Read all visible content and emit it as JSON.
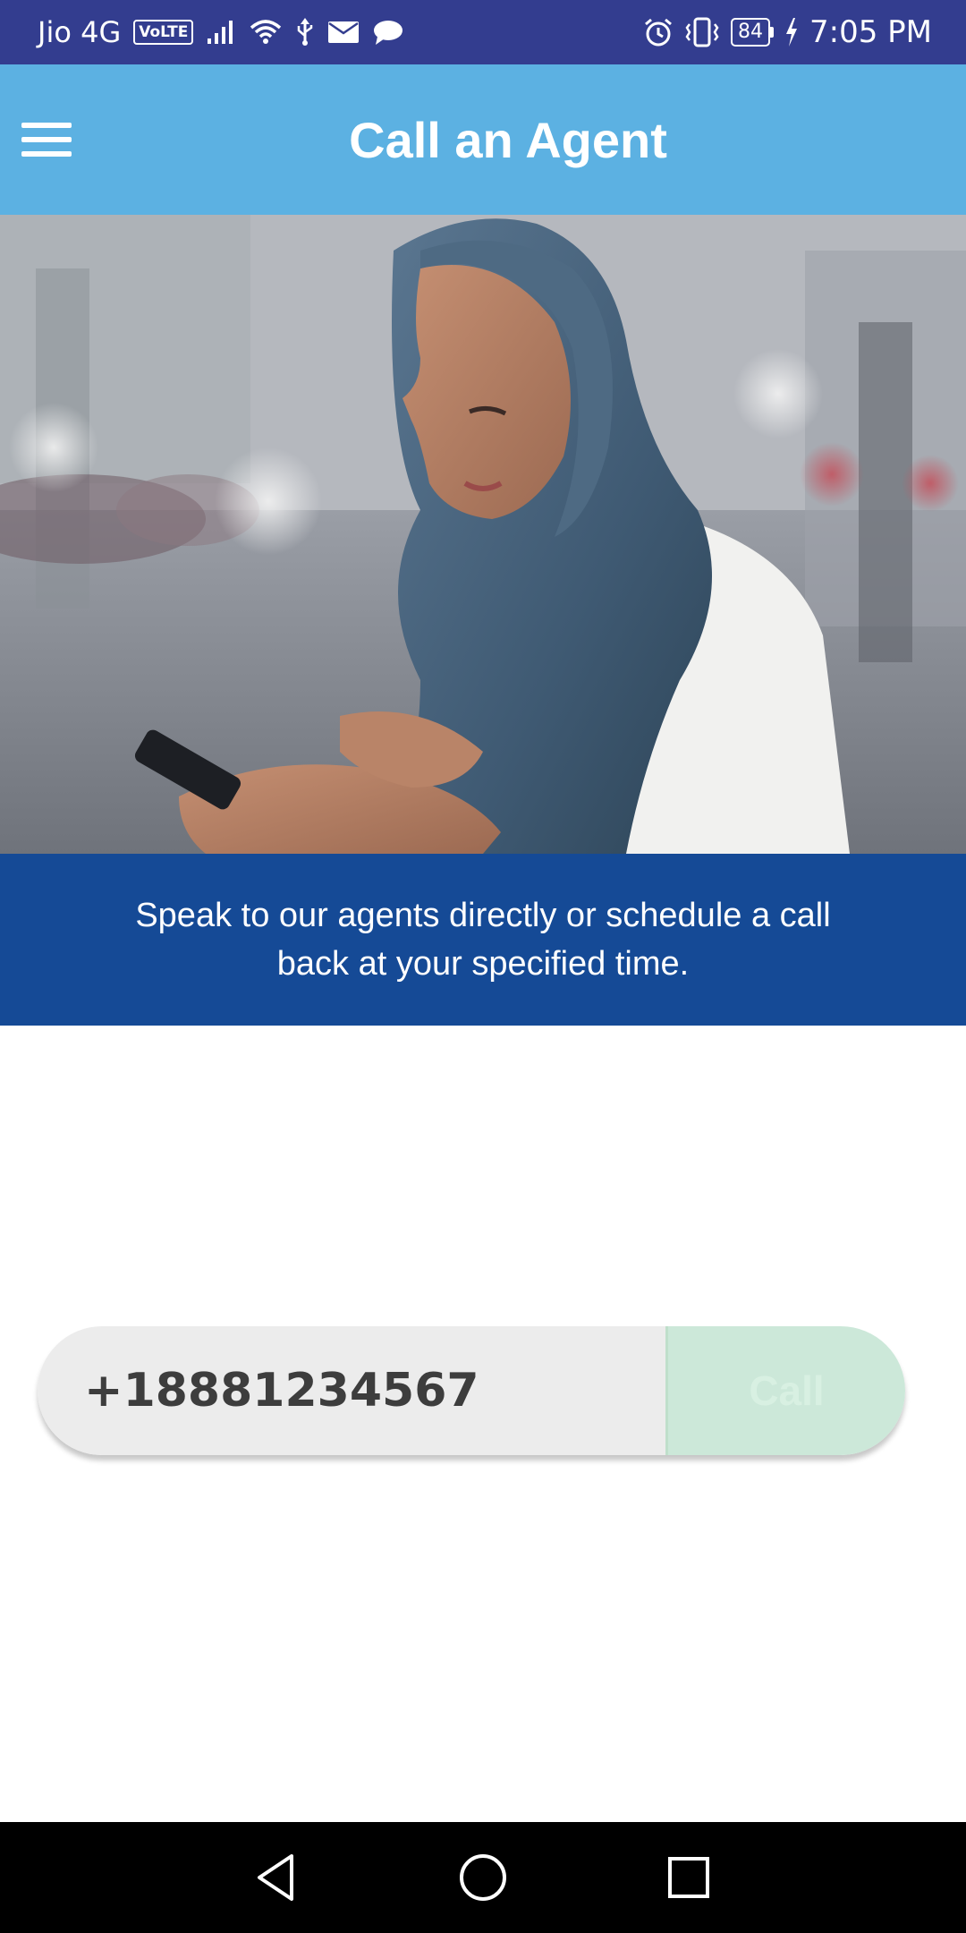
{
  "status_bar": {
    "carrier": "Jio 4G",
    "volte": "VoLTE",
    "battery": "84",
    "time": "7:05 PM",
    "icons": [
      "signal-icon",
      "wifi-icon",
      "usb-icon",
      "mail-icon",
      "chat-icon",
      "alarm-icon",
      "vibrate-icon",
      "battery-icon",
      "charging-icon"
    ]
  },
  "app_bar": {
    "title": "Call an Agent",
    "menu_icon": "hamburger-menu-icon",
    "background": "#5cb1e2"
  },
  "hero": {
    "image": "woman-using-phone-photo"
  },
  "banner": {
    "text": "Speak to our agents directly or schedule a call back at your specified time.",
    "background": "#154a96"
  },
  "call_form": {
    "phone_number": "+18881234567",
    "call_label": "Call",
    "call_button_color": "#cce8d9"
  },
  "nav_bar": {
    "icons": [
      "back-icon",
      "home-icon",
      "recents-icon"
    ]
  }
}
